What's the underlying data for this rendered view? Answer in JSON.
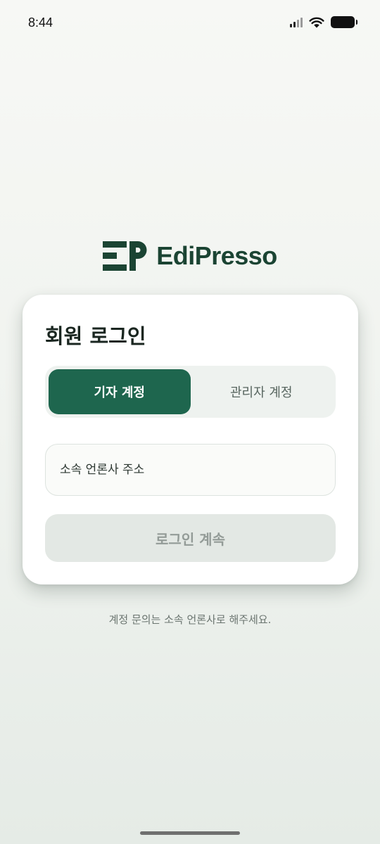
{
  "status_bar": {
    "time": "8:44",
    "icons": [
      "cellular-signal-icon",
      "wifi-icon",
      "battery-icon"
    ]
  },
  "brand": {
    "name": "EdiPresso",
    "logo_icon": "ep-logo-mark",
    "color": "#1b4433"
  },
  "login": {
    "title": "회원 로그인",
    "tabs": [
      {
        "label": "기자 계정",
        "selected": true
      },
      {
        "label": "관리자 계정",
        "selected": false
      }
    ],
    "input": {
      "placeholder": "소속 언론사 주소",
      "value": ""
    },
    "submit_label": "로그인 계속",
    "help_text": "계정 문의는 소속 언론사로 해주세요."
  },
  "colors": {
    "accent": "#1e664e",
    "button_disabled_bg": "#e3e8e4",
    "button_disabled_text": "#939b97"
  }
}
